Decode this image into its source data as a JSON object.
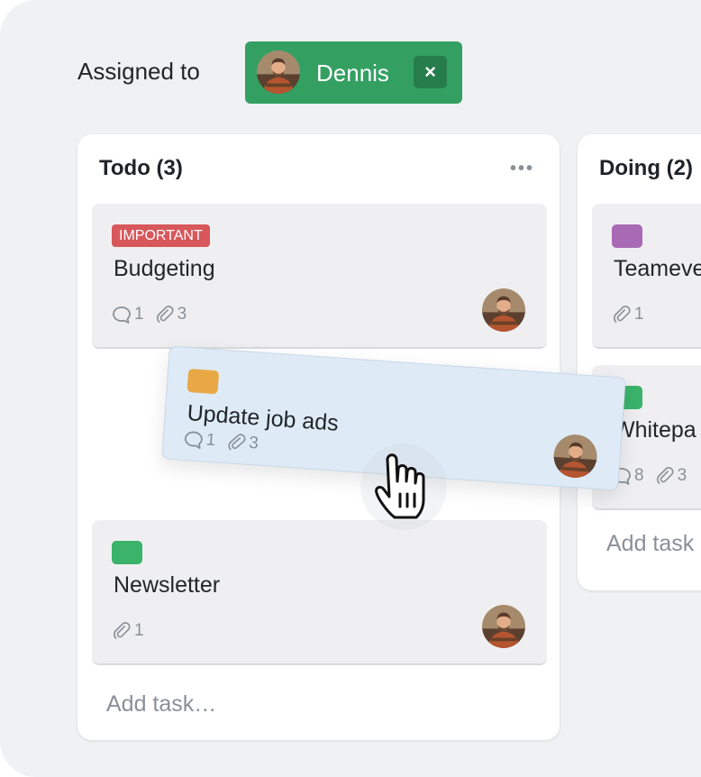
{
  "filter": {
    "label": "Assigned to",
    "assignee": "Dennis",
    "close_symbol": "×",
    "chip_color": "#33a062"
  },
  "columns": [
    {
      "title": "Todo (3)",
      "menu": "•••",
      "add_task": "Add task…",
      "cards": [
        {
          "tag": "IMPORTANT",
          "tag_color": "#d7575a",
          "title": "Budgeting",
          "comments": "1",
          "attachments": "3"
        },
        {
          "tag_color": "#3bb36b",
          "title": "Newsletter",
          "attachments": "1"
        }
      ]
    },
    {
      "title": "Doing (2)",
      "add_task": "Add task",
      "cards": [
        {
          "tag_color": "#a86ab5",
          "title": "Teameve",
          "attachments": "1"
        },
        {
          "tag_color": "#3bb36b",
          "title": "Whitepa",
          "comments": "8",
          "attachments": "3"
        }
      ]
    }
  ],
  "dragging_card": {
    "tag_color": "#e8a845",
    "title": "Update job ads",
    "comments": "1",
    "attachments": "3"
  },
  "icons": [
    "comment-icon",
    "paperclip-icon",
    "avatar",
    "grab-hand-cursor-icon",
    "close-icon",
    "more-icon"
  ]
}
